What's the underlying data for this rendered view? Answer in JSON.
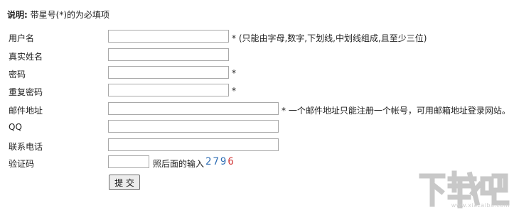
{
  "note": {
    "label": "说明:",
    "text": "带星号(*)的为必填项"
  },
  "fields": [
    {
      "label": "用户名",
      "value": "",
      "hint": "* (只能由字母,数字,下划线,中划线组成,且至少三位)"
    },
    {
      "label": "真实姓名",
      "value": "",
      "hint": ""
    },
    {
      "label": "密码",
      "value": "",
      "hint": "*"
    },
    {
      "label": "重复密码",
      "value": "",
      "hint": "*"
    },
    {
      "label": "邮件地址",
      "value": "",
      "hint": "* 一个邮件地址只能注册一个帐号，可用邮箱地址登录网站。"
    },
    {
      "label": "QQ",
      "value": "",
      "hint": ""
    },
    {
      "label": "联系电话",
      "value": "",
      "hint": ""
    }
  ],
  "captcha": {
    "label": "验证码",
    "value": "",
    "instruction": "照后面的输入",
    "digits": [
      {
        "d": "2",
        "color": "#2e6db4"
      },
      {
        "d": "7",
        "color": "#2e6db4"
      },
      {
        "d": "9",
        "color": "#2e6db4"
      },
      {
        "d": "6",
        "color": "#d23b3b"
      }
    ]
  },
  "submit_label": "提 交",
  "watermark": {
    "logo": "下载吧",
    "url": "www.xiazaiba.com"
  }
}
